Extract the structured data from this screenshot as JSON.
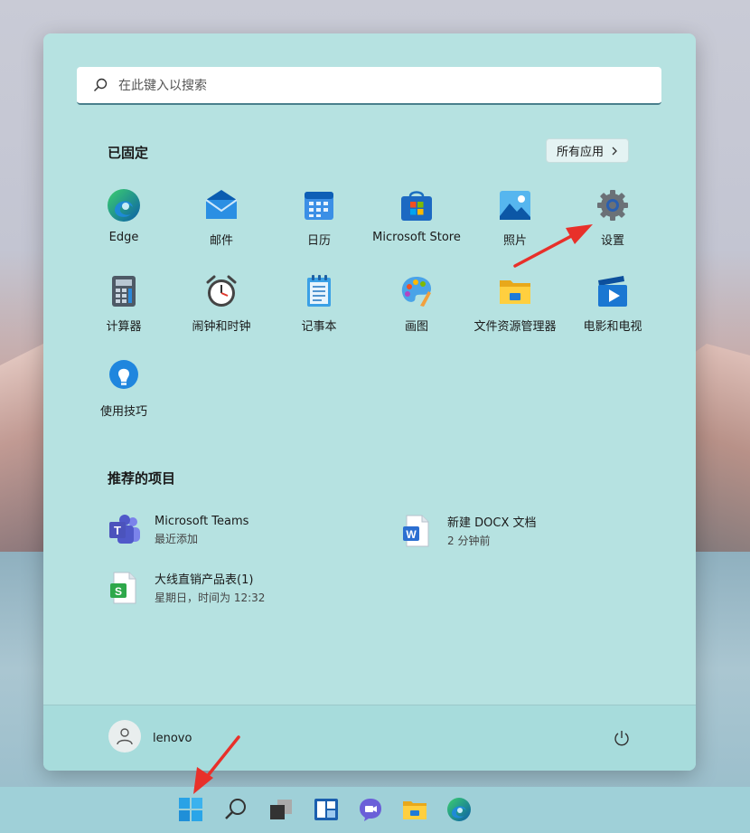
{
  "search": {
    "placeholder": "在此键入以搜索"
  },
  "pinned": {
    "title": "已固定",
    "all_apps_label": "所有应用",
    "apps": [
      {
        "label": "Edge",
        "icon": "edge-icon"
      },
      {
        "label": "邮件",
        "icon": "mail-icon"
      },
      {
        "label": "日历",
        "icon": "calendar-icon"
      },
      {
        "label": "Microsoft Store",
        "icon": "store-icon"
      },
      {
        "label": "照片",
        "icon": "photos-icon"
      },
      {
        "label": "设置",
        "icon": "settings-gear-icon"
      },
      {
        "label": "计算器",
        "icon": "calculator-icon"
      },
      {
        "label": "闹钟和时钟",
        "icon": "alarm-clock-icon"
      },
      {
        "label": "记事本",
        "icon": "notepad-icon"
      },
      {
        "label": "画图",
        "icon": "paint-palette-icon"
      },
      {
        "label": "文件资源管理器",
        "icon": "folder-icon"
      },
      {
        "label": "电影和电视",
        "icon": "movies-tv-icon"
      },
      {
        "label": "使用技巧",
        "icon": "tips-lightbulb-icon"
      }
    ]
  },
  "recommended": {
    "title": "推荐的项目",
    "items": [
      {
        "name": "Microsoft Teams",
        "subtitle": "最近添加",
        "icon": "teams-icon"
      },
      {
        "name": "新建 DOCX 文档",
        "subtitle": "2 分钟前",
        "icon": "word-doc-icon"
      },
      {
        "name": "大线直销产品表(1)",
        "subtitle": "星期日，时间为 12:32",
        "icon": "spreadsheet-icon"
      }
    ]
  },
  "footer": {
    "user_name": "lenovo"
  },
  "taskbar": {
    "icons": [
      "windows-start-icon",
      "search-icon",
      "task-view-icon",
      "widgets-icon",
      "chat-icon",
      "file-explorer-icon",
      "edge-icon"
    ]
  },
  "colors": {
    "menu_bg": "#b6e2e1",
    "footer_bg": "#a7dcdc",
    "taskbar_bg": "#9fd0d8",
    "annotation_arrow": "#e8302a"
  }
}
